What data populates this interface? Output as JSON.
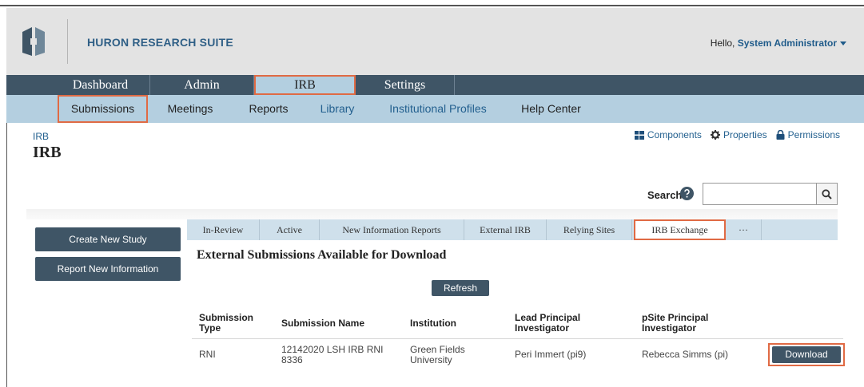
{
  "header": {
    "brand": "HURON RESEARCH SUITE",
    "greeting": "Hello,",
    "user": "System Administrator"
  },
  "mainnav": {
    "tabs": [
      {
        "label": "Dashboard"
      },
      {
        "label": "Admin"
      },
      {
        "label": "IRB"
      },
      {
        "label": "Settings"
      }
    ]
  },
  "subnav": {
    "items": [
      {
        "label": "Submissions"
      },
      {
        "label": "Meetings"
      },
      {
        "label": "Reports"
      },
      {
        "label": "Library"
      },
      {
        "label": "Institutional Profiles"
      },
      {
        "label": "Help Center"
      }
    ]
  },
  "page": {
    "breadcrumb": "IRB",
    "title": "IRB"
  },
  "toplinks": {
    "components": "Components",
    "properties": "Properties",
    "permissions": "Permissions"
  },
  "search": {
    "label": "Search",
    "value": ""
  },
  "actions": {
    "create_study": "Create New Study",
    "report_info": "Report New Information"
  },
  "tabs": [
    {
      "label": "In-Review"
    },
    {
      "label": "Active"
    },
    {
      "label": "New Information Reports"
    },
    {
      "label": "External IRB"
    },
    {
      "label": "Relying Sites"
    },
    {
      "label": "IRB Exchange"
    },
    {
      "label": "···"
    }
  ],
  "section": {
    "title": "External Submissions Available for Download",
    "refresh": "Refresh"
  },
  "table": {
    "headers": {
      "type_1": "Submission",
      "type_2": "Type",
      "name": "Submission Name",
      "institution": "Institution",
      "lead_pi_1": "Lead Principal",
      "lead_pi_2": "Investigator",
      "psite_pi_1": "pSite Principal",
      "psite_pi_2": "Investigator"
    },
    "rows": [
      {
        "type": "RNI",
        "name_1": "12142020 LSH IRB RNI",
        "name_2": "8336",
        "inst_1": "Green Fields",
        "inst_2": "University",
        "lead_pi": "Peri Immert (pi9)",
        "psite_pi": "Rebecca Simms (pi)",
        "action": "Download"
      }
    ]
  },
  "colors": {
    "nav_dark": "#3f5566",
    "nav_light": "#b4cfe0",
    "highlight": "#e06a44",
    "link": "#23608f"
  }
}
